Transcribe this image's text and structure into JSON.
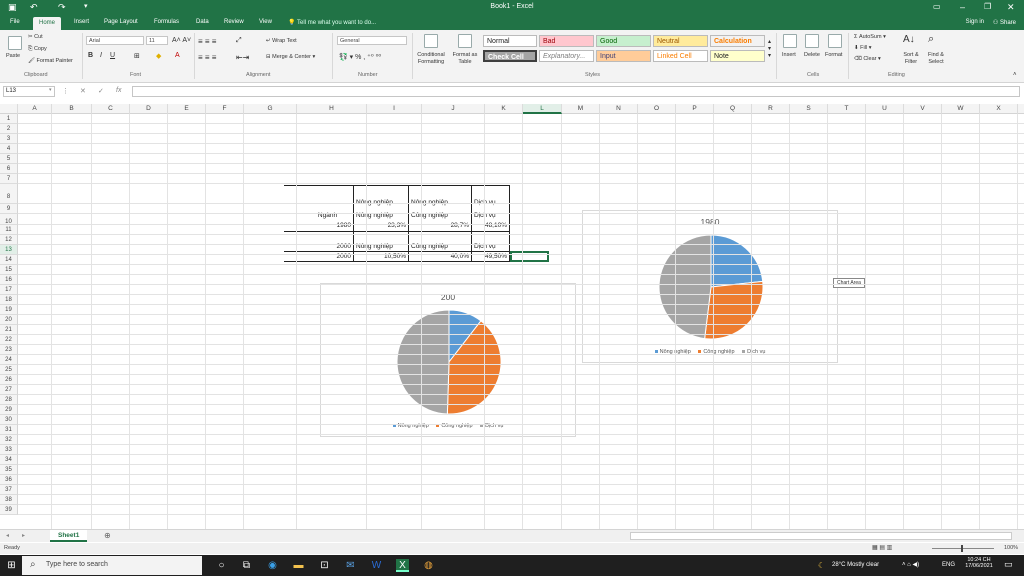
{
  "app": {
    "title": "Book1 - Excel"
  },
  "tabs": [
    "File",
    "Home",
    "Insert",
    "Page Layout",
    "Formulas",
    "Data",
    "Review",
    "View"
  ],
  "tell_me": "Tell me what you want to do...",
  "signin": "Sign in",
  "share": "Share",
  "ribbon": {
    "clipboard": {
      "cut": "Cut",
      "copy": "Copy",
      "paste": "Paste",
      "painter": "Format Painter",
      "label": "Clipboard"
    },
    "font": {
      "name": "Arial",
      "size": "11",
      "label": "Font"
    },
    "alignment": {
      "wrap": "Wrap Text",
      "merge": "Merge & Center",
      "label": "Alignment"
    },
    "number": {
      "format": "General",
      "label": "Number"
    },
    "styles": {
      "conditional": "Conditional Formatting",
      "format_table": "Format as Table",
      "cells": [
        "Normal",
        "Bad",
        "Good",
        "Neutral",
        "Calculation",
        "Check Cell",
        "Explanatory...",
        "Input",
        "Linked Cell",
        "Note"
      ],
      "label": "Styles"
    },
    "cells": {
      "insert": "Insert",
      "delete": "Delete",
      "format": "Format",
      "label": "Cells"
    },
    "editing": {
      "autosum": "AutoSum",
      "fill": "Fill",
      "clear": "Clear",
      "sort": "Sort & Filter",
      "find": "Find & Select",
      "label": "Editing"
    }
  },
  "formula_bar": {
    "name_box": "L13",
    "formula": ""
  },
  "columns": [
    "A",
    "B",
    "C",
    "D",
    "E",
    "F",
    "G",
    "H",
    "I",
    "J",
    "K",
    "L",
    "M",
    "N",
    "O",
    "P",
    "Q",
    "R",
    "S",
    "T",
    "U",
    "V",
    "W",
    "X"
  ],
  "selected_column": "L",
  "rows": [
    "1",
    "2",
    "3",
    "4",
    "5",
    "6",
    "7",
    "8",
    "9",
    "10",
    "11",
    "12",
    "13",
    "14",
    "15",
    "16",
    "17",
    "18",
    "19",
    "20",
    "21",
    "22",
    "23",
    "24",
    "25",
    "26",
    "27",
    "28",
    "29",
    "30",
    "31",
    "32",
    "33",
    "34",
    "35",
    "36",
    "37",
    "38",
    "39"
  ],
  "selected_row": "13",
  "cells": {
    "I8": "Nông nghiệp",
    "J8": "Nông nghiệp",
    "K8": "Dịch vụ",
    "H9": "Ngành",
    "I9": "Nông nghiệp",
    "J9": "Công nghiệp",
    "K9": "Dịch vụ",
    "H10": "1980",
    "I10": "23,3%",
    "J10": "28,7%",
    "K10": "48,10%",
    "H12": "2000",
    "I12": "Nông nghiệp",
    "J12": "Công nghiệp",
    "K12": "Dịch vụ",
    "H13": "2000",
    "I13": "10,50%",
    "J13": "40,0%",
    "K13": "49,50%"
  },
  "chart_data": [
    {
      "type": "pie",
      "title": "1980",
      "categories": [
        "Nông nghiệp",
        "Công nghiệp",
        "Dịch vụ"
      ],
      "values": [
        23.3,
        28.7,
        48.1
      ],
      "colors": [
        "#5b9bd5",
        "#ed7d31",
        "#a5a5a5"
      ],
      "legend": "bottom"
    },
    {
      "type": "pie",
      "title": "200",
      "categories": [
        "Nông nghiệp",
        "Công nghiệp",
        "Dịch vụ"
      ],
      "values": [
        10.5,
        40.0,
        49.5
      ],
      "colors": [
        "#5b9bd5",
        "#ed7d31",
        "#a5a5a5"
      ],
      "legend": "bottom"
    }
  ],
  "tooltip": "Chart Area",
  "sheet": {
    "name": "Sheet1"
  },
  "status": {
    "ready": "Ready",
    "zoom": "100%"
  },
  "taskbar": {
    "search": "Type here to search",
    "weather": "28°C  Mostly clear",
    "lang": "ENG",
    "time": "10:24 CH",
    "date": "17/06/2021"
  },
  "colors": {
    "accent": "#217346"
  }
}
